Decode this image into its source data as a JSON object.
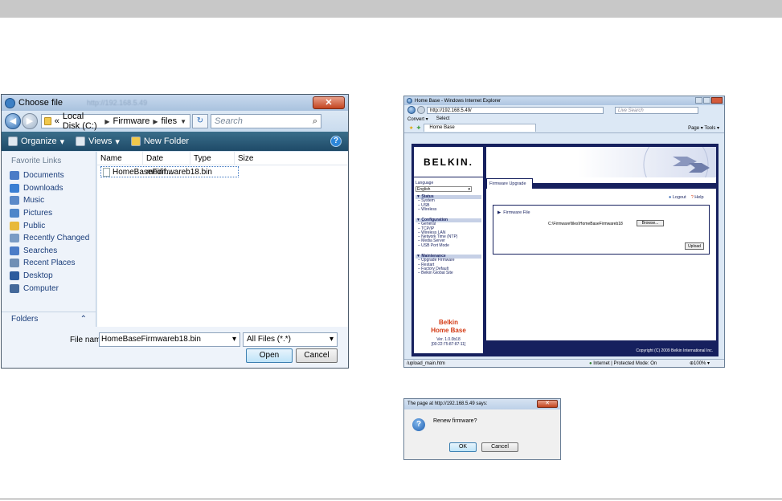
{
  "choose_dialog": {
    "title": "Choose file",
    "breadcrumb": [
      "«",
      "Local Disk (C:)",
      "Firmware",
      "files"
    ],
    "search_placeholder": "Search",
    "toolbar": {
      "organize": "Organize",
      "views": "Views",
      "new_folder": "New Folder"
    },
    "favorite_links_header": "Favorite Links",
    "favorites": [
      {
        "label": "Documents",
        "icon": "documents-icon",
        "color": "#4b7cc7"
      },
      {
        "label": "Downloads",
        "icon": "downloads-icon",
        "color": "#3a7fd3"
      },
      {
        "label": "Music",
        "icon": "music-icon",
        "color": "#5a89c8"
      },
      {
        "label": "Pictures",
        "icon": "pictures-icon",
        "color": "#4e86c9"
      },
      {
        "label": "Public",
        "icon": "public-folder-icon",
        "color": "#e8b93a"
      },
      {
        "label": "Recently Changed",
        "icon": "recently-changed-icon",
        "color": "#7a9cc5"
      },
      {
        "label": "Searches",
        "icon": "searches-icon",
        "color": "#4b7cc7"
      },
      {
        "label": "Recent Places",
        "icon": "recent-places-icon",
        "color": "#6f8fb5"
      },
      {
        "label": "Desktop",
        "icon": "desktop-icon",
        "color": "#2d5c9e"
      },
      {
        "label": "Computer",
        "icon": "computer-icon",
        "color": "#44699a"
      }
    ],
    "folders_label": "Folders",
    "columns": [
      "Name",
      "Date modif...",
      "Type",
      "Size"
    ],
    "files": [
      "HomeBaseFirmwareb18.bin"
    ],
    "file_name_label": "File name:",
    "file_name_value": "HomeBaseFirmwareb18.bin",
    "file_type_value": "All Files (*.*)",
    "open_button": "Open",
    "cancel_button": "Cancel"
  },
  "browser": {
    "title": "Home Base - Windows Internet Explorer",
    "url": "http://192.168.5.49/",
    "search_placeholder": "Live Search",
    "menu": [
      "Convert",
      "Select"
    ],
    "tab_label": "Home Base",
    "tools": "Page ▾   Tools ▾",
    "logo": "BELKIN.",
    "language_label": "Language",
    "language_value": "English",
    "status_section": {
      "header": "Status",
      "items": [
        "System",
        "USB",
        "Wireless"
      ]
    },
    "config_section": {
      "header": "Configuration",
      "items": [
        "General",
        "TCP/IP",
        "Wireless LAN",
        "Network Time (NTP)",
        "Media Server",
        "USB Port Mode"
      ]
    },
    "maint_section": {
      "header": "Maintenance",
      "items": [
        "Upgrade Firmware",
        "Restart",
        "Factory Default",
        "Belkin Global Site"
      ]
    },
    "brand_line1": "Belkin",
    "brand_line2": "Home Base",
    "version": "Ver. 1.0.0b18",
    "mac": "[00:22:75:87:87:11]",
    "firmware_tab": "Firmware Upgrade",
    "logout": "Logout",
    "help": "Help",
    "firmware_file_label": "Firmware File",
    "firmware_path": "C:\\Firmware\\files\\HomeBaseFirmwareb18",
    "browse_button": "Browse...",
    "upload_button": "Upload",
    "copyright": "Copyright (C) 2009 Belkin International Inc.",
    "status_url": "/upload_main.htm",
    "zone": "Internet | Protected Mode: On",
    "zoom": "100%"
  },
  "confirm_dialog": {
    "title": "The page at http://192.168.5.49 says:",
    "message": "Renew firmware?",
    "ok_button": "OK",
    "cancel_button": "Cancel"
  }
}
